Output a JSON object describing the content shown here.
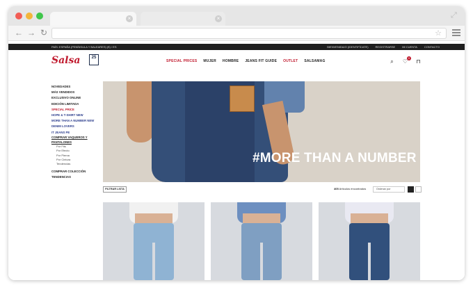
{
  "browser": {
    "tab_close_glyph": "×",
    "url": ""
  },
  "site": {
    "utility_left": "PAÍS: ESPAÑA (PENÍNSULA Y BALEARES) (€) / ES",
    "utility_right": [
      "BIENVENIDA/O (IDENTIFÍCATE)",
      "REGISTRARSE",
      "MI CUENTA",
      "CONTACTO"
    ],
    "logo": "Salsa",
    "logo_badge": "25",
    "nav": [
      {
        "label": "SPECIAL PRICES",
        "color": "#c0192d"
      },
      {
        "label": "MUJER",
        "color": "#222222"
      },
      {
        "label": "HOMBRE",
        "color": "#222222"
      },
      {
        "label": "JEANS FIT GUIDE",
        "color": "#222222"
      },
      {
        "label": "OUTLET",
        "color": "#c0192d"
      },
      {
        "label": "SALSAMAG",
        "color": "#222222"
      }
    ],
    "icons": [
      "search-icon",
      "wishlist-icon",
      "bag-icon"
    ],
    "wishlist_count": "0"
  },
  "sidebar": {
    "items": [
      {
        "label": "NOVEDADES",
        "style": "normal"
      },
      {
        "label": "MÁS VENDIDOS",
        "style": "normal"
      },
      {
        "label": "EXCLUSIVO ONLINE",
        "style": "normal"
      },
      {
        "label": "EDICIÓN LIMITADA",
        "style": "normal"
      },
      {
        "label": "SPECIAL PRICE",
        "style": "red"
      },
      {
        "label": "HOPE & T-SHIRT NEW",
        "style": "blue"
      },
      {
        "label": "MORE THAN A NUMBER NEW",
        "style": "blue"
      },
      {
        "label": "DENIM LOVERS",
        "style": "blue"
      },
      {
        "label": "IT JEANS PE",
        "style": "blue"
      },
      {
        "label": "COMPRAR VAQUEROS Y",
        "style": "under"
      },
      {
        "label": "PANTALONES",
        "style": "under"
      }
    ],
    "subitems": [
      "Por Fits",
      "Por Efecto",
      "Por Pierna",
      "Por Cintura",
      "Tendencias"
    ],
    "bottom_items": [
      "COMPRAR COLECCIÓN",
      "TENDENCIAS"
    ]
  },
  "hero": {
    "text": "#MORE THAN A NUMBER",
    "patch_text": "YOU ARE MORE THAN A NUMBER"
  },
  "filterbar": {
    "filter_label": "FILTRAR LISTA",
    "count_number": "405",
    "count_text": "Artículos encontrados",
    "sort_label": "Ordenar por"
  },
  "products": [
    {
      "jeans_color": "#8fb3d3"
    },
    {
      "jeans_color": "#7f9fc2"
    },
    {
      "jeans_color": "#31507c"
    }
  ]
}
